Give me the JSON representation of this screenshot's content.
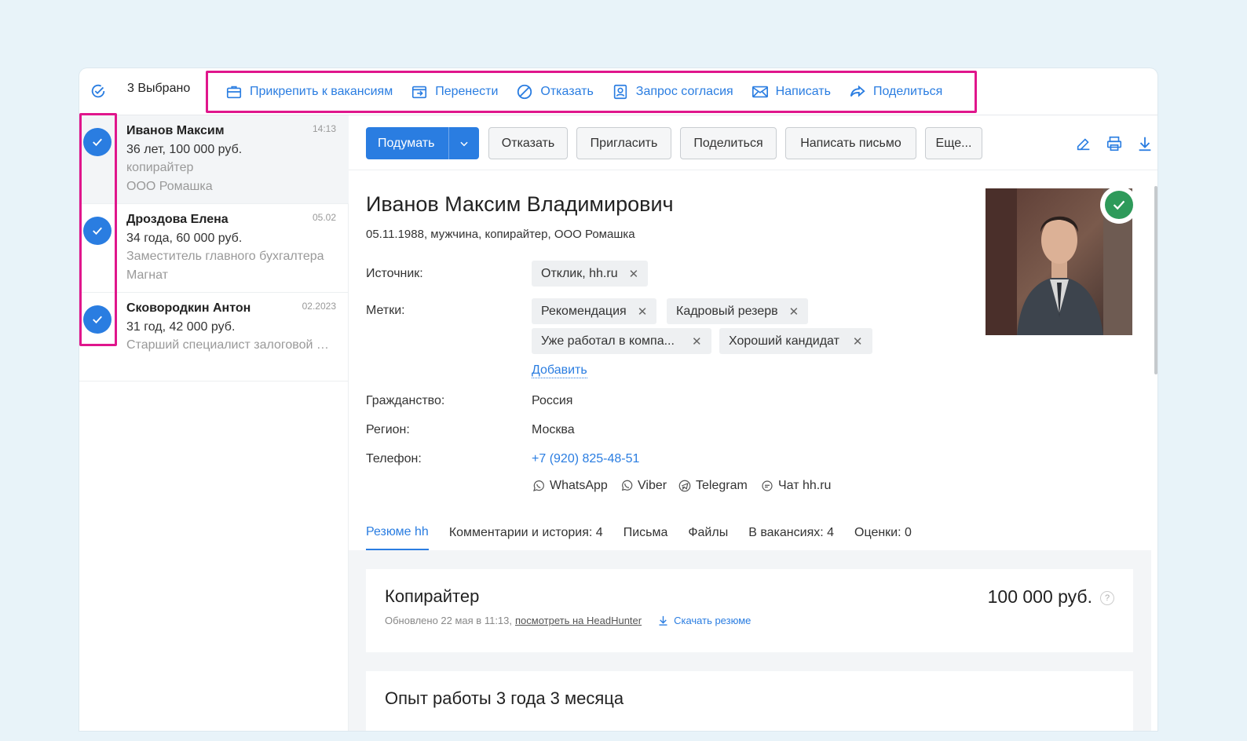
{
  "topbar": {
    "selected_count": "3 Выбрано",
    "bulk_actions": [
      {
        "label": "Прикрепить к вакансиям",
        "icon": "briefcase-icon"
      },
      {
        "label": "Перенести",
        "icon": "move-icon"
      },
      {
        "label": "Отказать",
        "icon": "ban-icon"
      },
      {
        "label": "Запрос согласия",
        "icon": "consent-icon"
      },
      {
        "label": "Написать",
        "icon": "mail-icon"
      },
      {
        "label": "Поделиться",
        "icon": "share-icon"
      }
    ]
  },
  "candidates": [
    {
      "name": "Иванов Максим",
      "date": "14:13",
      "line2": "36 лет, 100 000 руб.",
      "line3": "копирайтер",
      "line4": "ООО Ромашка",
      "checked": true
    },
    {
      "name": "Дроздова Елена",
      "date": "05.02",
      "line2": "34 года, 60 000 руб.",
      "line3": "Заместитель главного бухгалтера",
      "line4": "Магнат",
      "checked": true
    },
    {
      "name": "Сковородкин Антон",
      "date": "02.2023",
      "line2": "31 год, 42 000 руб.",
      "line3": "Старший специалист залоговой …",
      "line4": "",
      "checked": true
    }
  ],
  "actions": {
    "primary": "Подумать",
    "reject": "Отказать",
    "invite": "Пригласить",
    "share": "Поделиться",
    "write_letter": "Написать письмо",
    "more": "Еще..."
  },
  "profile": {
    "full_name": "Иванов Максим Владимирович",
    "subline": "05.11.1988, мужчина, копирайтер, ООО Ромашка",
    "source_label": "Источник:",
    "source_tag": "Отклик, hh.ru",
    "tags_label": "Метки:",
    "tags": [
      "Рекомендация",
      "Кадровый резерв",
      "Уже работал в компа...",
      "Хороший кандидат"
    ],
    "add_label": "Добавить",
    "citizenship_label": "Гражданство:",
    "citizenship": "Россия",
    "region_label": "Регион:",
    "region": "Москва",
    "phone_label": "Телефон:",
    "phone": "+7 (920) 825-48-51",
    "messengers": [
      "WhatsApp",
      "Viber",
      "Telegram",
      "Чат hh.ru"
    ]
  },
  "tabs": [
    "Резюме hh",
    "Комментарии и история: 4",
    "Письма",
    "Файлы",
    "В вакансиях: 4",
    "Оценки: 0"
  ],
  "resume": {
    "title": "Копирайтер",
    "salary": "100 000 руб.",
    "updated": "Обновлено 22 мая в 11:13,",
    "view_link": "посмотреть на HeadHunter",
    "download": "Скачать резюме",
    "experience_title": "Опыт работы 3 года 3 месяца"
  },
  "colors": {
    "accent": "#2a7de1",
    "highlight": "#e0168c",
    "success": "#2e9a5a"
  }
}
